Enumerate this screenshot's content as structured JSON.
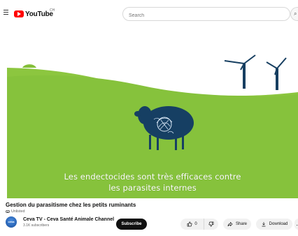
{
  "header": {
    "logo_text": "YouTube",
    "country_code": "CH",
    "search_placeholder": "Search",
    "menu_icon": "menu-icon",
    "search_icon": "search-icon"
  },
  "video": {
    "subtitle_line_1": "Les endectocides sont très efficaces contre",
    "subtitle_line_2": "les parasites internes",
    "scene": {
      "sky_color": "#ffffff",
      "field_color": "#89c53f",
      "sheep_color": "#163f63",
      "turbine_color": "#173f61"
    }
  },
  "details": {
    "title": "Gestion du parasitisme chez les petits ruminants",
    "visibility": "Unlisted",
    "channel": {
      "avatar_text": "ceva",
      "name": "Ceva TV - Ceva Santé Animale Channel",
      "subscribers": "3.1K subscribers"
    },
    "actions": {
      "subscribe": "Subscribe",
      "like_count": "0",
      "share": "Share",
      "download": "Download",
      "more": "…"
    }
  }
}
